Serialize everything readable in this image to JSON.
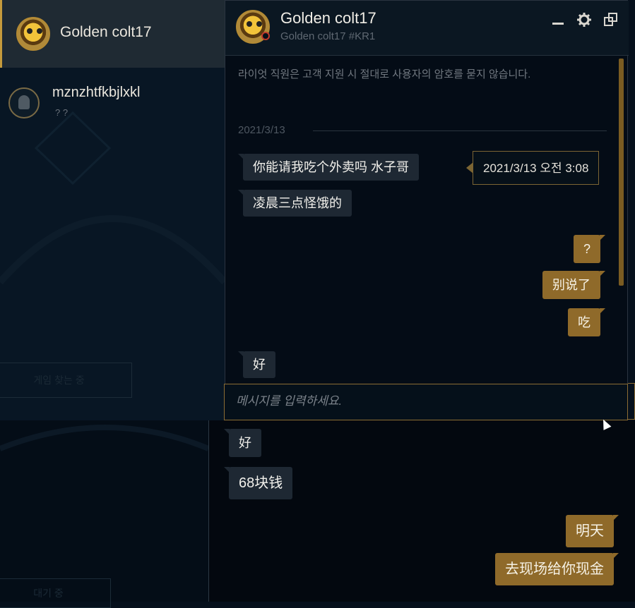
{
  "friends": [
    {
      "name": "Golden colt17",
      "selected": true
    },
    {
      "name": "mznzhtfkbjlxkl",
      "status": "? ?"
    }
  ],
  "left_ghost_buttons": [
    "게임 찾는 중",
    "대기 중"
  ],
  "chat": {
    "name": "Golden colt17",
    "riot_id": "Golden colt17 #KR1",
    "notice": "라이엇 직원은 고객 지원 시 절대로 사용자의 암호를 묻지 않습니다.",
    "date": "2021/3/13",
    "tooltip": "2021/3/13 오전 3:08",
    "messages": [
      {
        "dir": "in",
        "text": "你能请我吃个外卖吗 水子哥"
      },
      {
        "dir": "in",
        "text": "凌晨三点怪饿的"
      },
      {
        "dir": "out",
        "text": "?"
      },
      {
        "dir": "out",
        "text": "别说了"
      },
      {
        "dir": "out",
        "text": "吃"
      },
      {
        "dir": "in",
        "text": "好"
      }
    ],
    "input_placeholder": "메시지를 입력하세요."
  },
  "lower_messages": [
    {
      "dir": "in",
      "text": "好"
    },
    {
      "dir": "in",
      "text": "68块钱"
    },
    {
      "dir": "out",
      "text": "明天"
    },
    {
      "dir": "out",
      "text": "去现场给你现金"
    }
  ],
  "colors": {
    "accent": "#8f6a2a",
    "bubble_in": "#1e2833",
    "background": "#040c16"
  },
  "icons": [
    "minimize-icon",
    "gear-icon",
    "popout-icon"
  ]
}
